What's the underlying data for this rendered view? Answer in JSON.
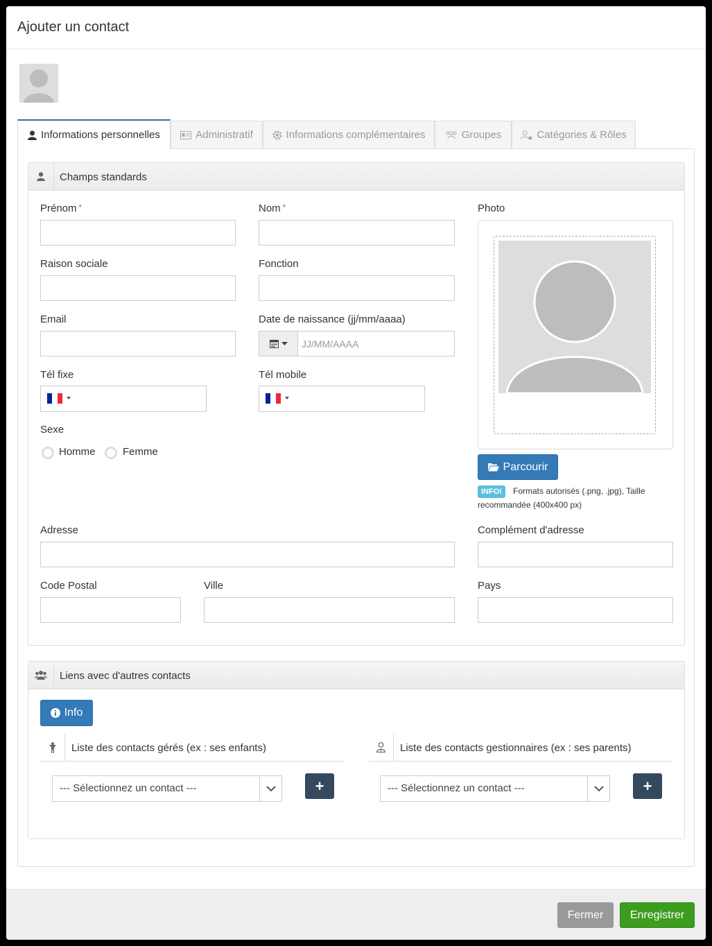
{
  "modal": {
    "title": "Ajouter un contact"
  },
  "tabs": [
    {
      "label": "Informations personnelles",
      "icon": "user-icon"
    },
    {
      "label": "Administratif",
      "icon": "id-card-icon"
    },
    {
      "label": "Informations complémentaires",
      "icon": "gear-icon"
    },
    {
      "label": "Groupes",
      "icon": "users-icon"
    },
    {
      "label": "Catégories & Rôles",
      "icon": "user-tag-icon"
    }
  ],
  "standard": {
    "title": "Champs standards",
    "prenom": "Prénom",
    "nom": "Nom",
    "required_mark": "*",
    "raison_sociale": "Raison sociale",
    "fonction": "Fonction",
    "email": "Email",
    "date_naissance": "Date de naissance (jj/mm/aaaa)",
    "date_placeholder": "JJ/MM/AAAA",
    "tel_fixe": "Tél fixe",
    "tel_mobile": "Tél mobile",
    "flag_colors": [
      "#002395",
      "#ffffff",
      "#ed2939"
    ],
    "sexe": "Sexe",
    "homme": "Homme",
    "femme": "Femme",
    "photo": "Photo",
    "parcourir": "Parcourir",
    "info_badge": "INFO!",
    "info_text": "Formats autorisés (.png, .jpg), Taille recommandée (400x400 px)",
    "adresse": "Adresse",
    "complement": "Complément d'adresse",
    "code_postal": "Code Postal",
    "ville": "Ville",
    "pays": "Pays"
  },
  "links": {
    "title": "Liens avec d'autres contacts",
    "info_button": "Info",
    "managed_title": "Liste des contacts gérés (ex : ses enfants)",
    "managers_title": "Liste des contacts gestionnaires (ex : ses parents)",
    "select_placeholder": "--- Sélectionnez un contact ---",
    "add_label": "+"
  },
  "footer": {
    "close": "Fermer",
    "save": "Enregistrer"
  },
  "colors": {
    "primary": "#337ab7",
    "success": "#3c9d1f",
    "dark": "#34495e",
    "info": "#5bc0de"
  }
}
